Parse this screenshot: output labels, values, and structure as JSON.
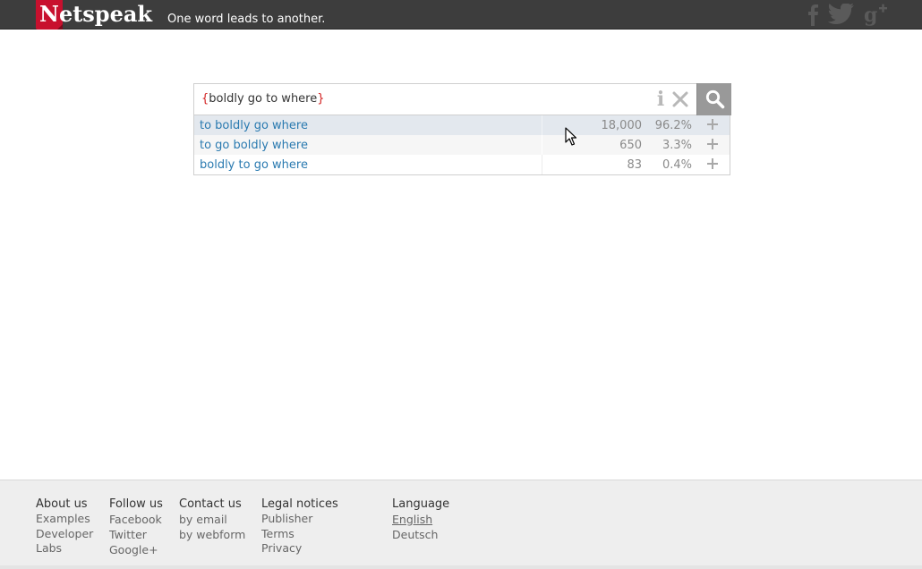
{
  "header": {
    "logo_text": "Netspeak",
    "tagline": "One word leads to another.",
    "social": [
      "facebook-icon",
      "twitter-icon",
      "google-plus-icon"
    ]
  },
  "search": {
    "brace_open": "{",
    "query_text": "boldly go to where",
    "brace_close": "}",
    "info_label": "i"
  },
  "results": [
    {
      "phrase": "to boldly go where",
      "count": "18,000",
      "percent": "96.2%"
    },
    {
      "phrase": "to go boldly where",
      "count": "650",
      "percent": "3.3%"
    },
    {
      "phrase": "boldly to go where",
      "count": "83",
      "percent": "0.4%"
    }
  ],
  "footer": {
    "about": {
      "title": "About us",
      "links": [
        "Examples",
        "Developer",
        "Labs"
      ]
    },
    "follow": {
      "title": "Follow us",
      "links": [
        "Facebook",
        "Twitter",
        "Google+"
      ]
    },
    "contact": {
      "title": "Contact us",
      "links": [
        "by email",
        "by webform"
      ]
    },
    "legal": {
      "title": "Legal notices",
      "links": [
        "Publisher",
        "Terms",
        "Privacy"
      ]
    },
    "language": {
      "title": "Language",
      "links": [
        "English",
        "Deutsch"
      ],
      "selected": "English"
    }
  },
  "colors": {
    "header_bg": "#3d3d3d",
    "logo_red": "#c8102e",
    "link_blue": "#2a7ab0",
    "search_button": "#999999",
    "highlight_row": "#e3e8ee",
    "footer_bg": "#eeeeee"
  }
}
